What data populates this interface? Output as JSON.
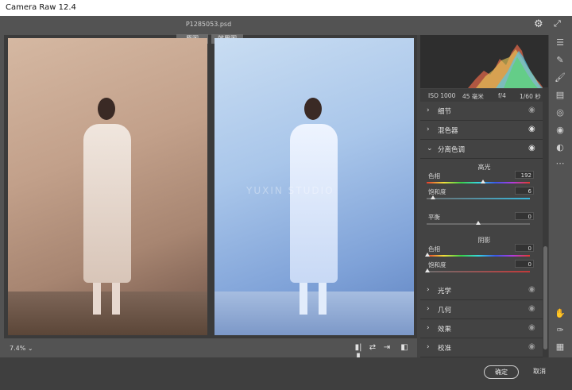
{
  "app": {
    "title": "Camera Raw 12.4",
    "file_name": "P1285053.psd"
  },
  "view": {
    "tab_before": "原图",
    "tab_after": "效果图",
    "zoom": "7.4%",
    "watermark": "YUXIN STUDIO"
  },
  "exif": {
    "iso": "ISO 1000",
    "focal": "45 毫米",
    "aperture": "f/4",
    "shutter": "1/60 秒"
  },
  "panels": [
    {
      "label": "细节",
      "expanded": false
    },
    {
      "label": "混色器",
      "expanded": false
    },
    {
      "label": "分离色调",
      "expanded": true
    },
    {
      "label": "光学",
      "expanded": false
    },
    {
      "label": "几何",
      "expanded": false
    },
    {
      "label": "效果",
      "expanded": false
    },
    {
      "label": "校准",
      "expanded": false
    }
  ],
  "split_toning": {
    "highlights_title": "高光",
    "highlight_hue": {
      "label": "色相",
      "value": "192"
    },
    "highlight_saturation": {
      "label": "饱和度",
      "value": "6"
    },
    "balance": {
      "label": "平衡",
      "value": "0"
    },
    "shadows_title": "阴影",
    "shadow_hue": {
      "label": "色相",
      "value": "0"
    },
    "shadow_saturation": {
      "label": "饱和度",
      "value": "0"
    }
  },
  "icons": {
    "settings": "gear-icon",
    "fullscreen": "expand-icon",
    "visibility": "eye-icon"
  },
  "buttons": {
    "ok": "确定",
    "cancel": "取消"
  },
  "colors": {
    "panel_bg": "#434343",
    "ok_border": "#cfcfcf"
  }
}
